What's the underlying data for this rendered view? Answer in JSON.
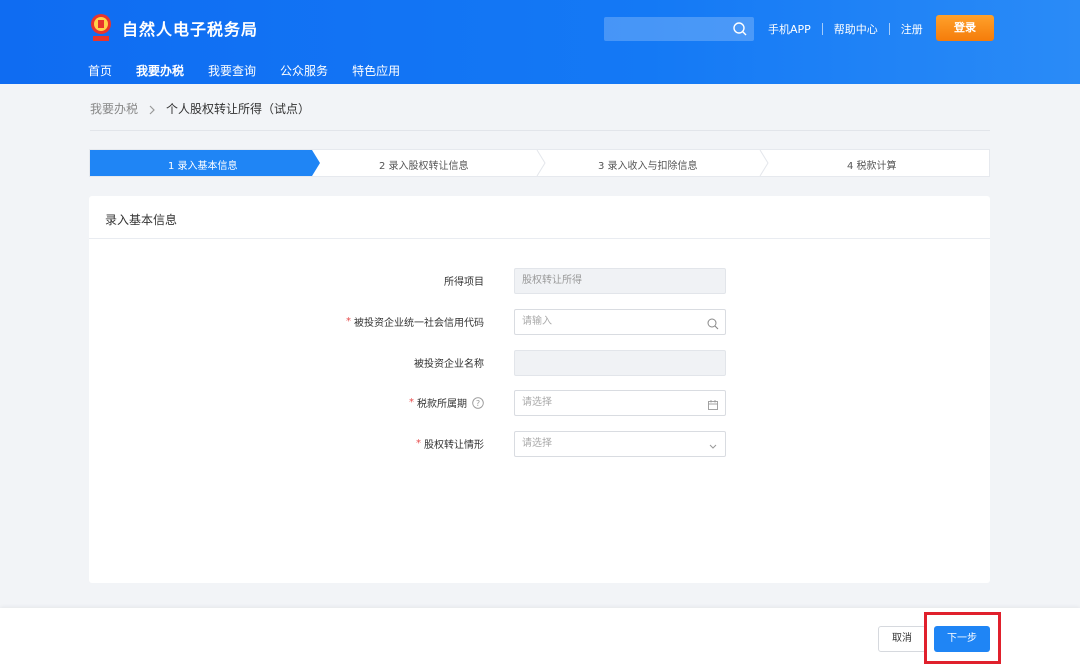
{
  "header": {
    "site_title": "自然人电子税务局",
    "search_placeholder": "",
    "links": [
      "手机APP",
      "帮助中心",
      "注册"
    ],
    "login_label": "登录",
    "nav": [
      {
        "label": "首页",
        "active": false
      },
      {
        "label": "我要办税",
        "active": true
      },
      {
        "label": "我要查询",
        "active": false
      },
      {
        "label": "公众服务",
        "active": false
      },
      {
        "label": "特色应用",
        "active": false
      }
    ]
  },
  "breadcrumb": {
    "parent": "我要办税",
    "current": "个人股权转让所得（试点）"
  },
  "steps": [
    {
      "label": "1  录入基本信息",
      "active": true
    },
    {
      "label": "2  录入股权转让信息",
      "active": false
    },
    {
      "label": "3  录入收入与扣除信息",
      "active": false
    },
    {
      "label": "4  税款计算",
      "active": false
    }
  ],
  "form": {
    "title": "录入基本信息",
    "fields": [
      {
        "label": "所得项目",
        "required": false,
        "value": "股权转让所得",
        "placeholder": "",
        "disabled": true,
        "icon": ""
      },
      {
        "label": "被投资企业统一社会信用代码",
        "required": true,
        "value": "",
        "placeholder": "请输入",
        "disabled": false,
        "icon": "search-icon"
      },
      {
        "label": "被投资企业名称",
        "required": false,
        "value": "",
        "placeholder": "",
        "disabled": true,
        "icon": ""
      },
      {
        "label": "税款所属期",
        "required": true,
        "value": "",
        "placeholder": "请选择",
        "disabled": false,
        "icon": "calendar-icon",
        "help": true
      },
      {
        "label": "股权转让情形",
        "required": true,
        "value": "",
        "placeholder": "请选择",
        "disabled": false,
        "icon": "chevron-down-icon"
      }
    ]
  },
  "footer": {
    "cancel_label": "取消",
    "next_label": "下一步"
  },
  "colors": {
    "header_blue": "#1479f5",
    "login_orange": "#f57c0a",
    "step_active": "#1f85f5",
    "primary_button": "#1f85f5",
    "highlight": "#e0202c",
    "required_asterisk": "#e64b4b"
  }
}
